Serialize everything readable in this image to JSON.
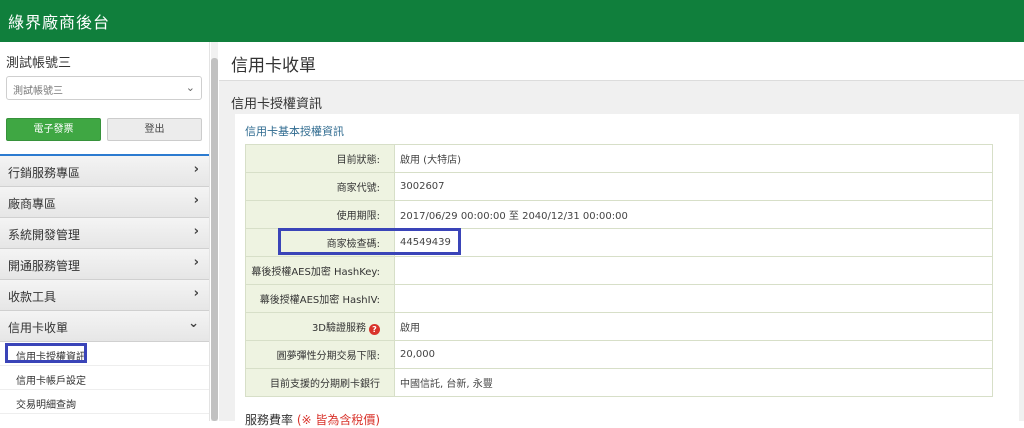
{
  "header": {
    "title": "綠界廠商後台"
  },
  "sidebar": {
    "account_name": "測試帳號三",
    "account_select": "測試帳號三",
    "invoice_button": "電子發票",
    "logout_button": "登出",
    "menu": [
      {
        "label": "行銷服務專區"
      },
      {
        "label": "廠商專區"
      },
      {
        "label": "系統開發管理"
      },
      {
        "label": "開通服務管理"
      },
      {
        "label": "收款工具"
      },
      {
        "label": "信用卡收單"
      }
    ],
    "submenu": [
      {
        "label": "信用卡授權資訊"
      },
      {
        "label": "信用卡帳戶設定"
      },
      {
        "label": "交易明細查詢"
      }
    ]
  },
  "main": {
    "page_title": "信用卡收單",
    "section_title": "信用卡授權資訊",
    "card_title": "信用卡基本授權資訊",
    "rows": [
      {
        "label": "目前狀態:",
        "value": "啟用 (大特店)"
      },
      {
        "label": "商家代號:",
        "value": "3002607"
      },
      {
        "label": "使用期限:",
        "value": "2017/06/29 00:00:00 至 2040/12/31 00:00:00"
      },
      {
        "label": "商家檢查碼:",
        "value": "44549439"
      },
      {
        "label": "幕後授權AES加密 HashKey:",
        "value": ""
      },
      {
        "label": "幕後授權AES加密 HashIV:",
        "value": ""
      },
      {
        "label": "3D驗證服務",
        "value": "啟用"
      },
      {
        "label": "圓夢彈性分期交易下限:",
        "value": "20,000"
      },
      {
        "label": "目前支援的分期刷卡銀行",
        "value": "中國信託, 台新, 永豐"
      }
    ],
    "section2_title": "服務費率",
    "section2_note": "(※ 皆為含稅價)"
  },
  "colors": {
    "brand": "#107f3c",
    "highlight": "#3a44b8",
    "invoice_button": "#3fa743"
  },
  "icons": {
    "select_chevron": "chevron-down-icon",
    "menu_arrow": "chevron-right-icon",
    "help": "question-circle-icon"
  }
}
